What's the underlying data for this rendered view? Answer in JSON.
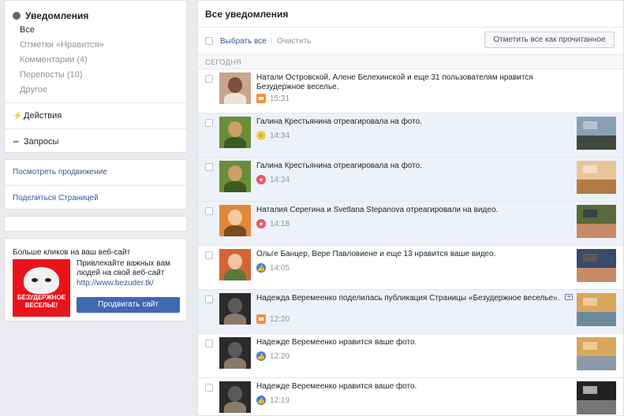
{
  "sidebar": {
    "header": "Уведомления",
    "filters": [
      "Все",
      "Отметки «Нравится»",
      "Комментарии (4)",
      "Перепосты (10)",
      "Другое"
    ],
    "actions": "Действия",
    "requests": "Запросы"
  },
  "links": {
    "promotion": "Посмотреть продвижение",
    "share_page": "Поделиться Страницей"
  },
  "ad": {
    "title": "Больше кликов на ваш веб-сайт",
    "image_text": "БЕЗУДЕРЖНОЕ ВЕСЕЛЬЕ!",
    "description": "Привлекайте важных вам людей на свой веб-сайт",
    "url": "http://www.bezuder.tk/",
    "button": "Продвигать сайт"
  },
  "main": {
    "title": "Все уведомления",
    "select_all": "Выбрать все",
    "clear": "Очистить",
    "mark_all_read": "Отметить все как прочитанное",
    "day_label": "СЕГОДНЯ"
  },
  "notifications": [
    {
      "text": "Натали Островской, Алене Белехинской и еще 31 пользователям нравится Безудержное веселье.",
      "time": "15:31",
      "icon": "comment-icon",
      "unread": false
    },
    {
      "text": "Галина Крестьянина отреагировала на фото.",
      "time": "14:34",
      "icon": "haha-icon",
      "unread": true
    },
    {
      "text": "Галина Крестьянина отреагировала на фото.",
      "time": "14:34",
      "icon": "love-icon",
      "unread": true
    },
    {
      "text": "Наталия Серегина и Svetlana Stepanova отреагировали на видео.",
      "time": "14:18",
      "icon": "love-icon",
      "unread": true
    },
    {
      "text": "Ольге Банцер, Вере Павловиене и еще 13 нравится ваше видео.",
      "time": "14:05",
      "icon": "like-icon",
      "unread": false
    },
    {
      "text": "Надежда Веремеенко поделилась публикация Страницы «Безудержное веселье».",
      "time": "12:20",
      "icon": "comment-icon",
      "unread": true
    },
    {
      "text": "Надежде Веремеенко нравится ваше фото.",
      "time": "12:20",
      "icon": "like-icon",
      "unread": false
    },
    {
      "text": "Надежде Веремеенко нравится ваше фото.",
      "time": "12:19",
      "icon": "like-icon",
      "unread": false
    }
  ],
  "colors": {
    "brand_blue": "#4267b2",
    "link_blue": "#365899",
    "unread_bg": "#edf2fa",
    "ad_red": "#e8141b"
  }
}
